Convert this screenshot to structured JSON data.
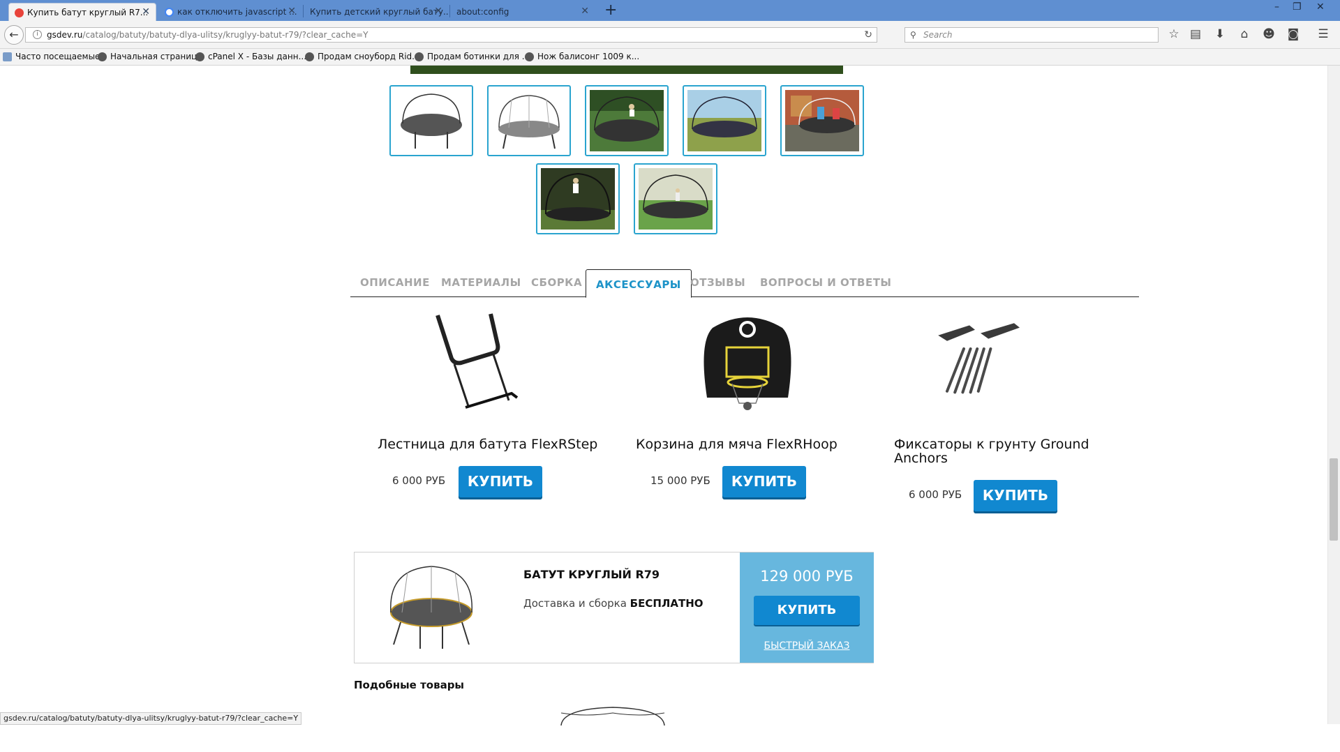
{
  "browser": {
    "tabs": [
      {
        "title": "Купить батут круглый R7...",
        "active": true
      },
      {
        "title": "как отключить javascript ...",
        "active": false
      },
      {
        "title": "Купить детский круглый бату...",
        "active": false
      },
      {
        "title": "about:config",
        "active": false
      }
    ],
    "new_tab_label": "+",
    "url_domain": "gsdev.ru",
    "url_path": "/catalog/batuty/batuty-dlya-ulitsy/kruglyy-batut-r79/?clear_cache=Y",
    "search_placeholder": "Search",
    "bookmarks": [
      "Часто посещаемые",
      "Начальная страница",
      "cPanel X - Базы данн...",
      "Продам сноуборд Rid...",
      "Продам ботинки для ...",
      "Нож балисонг 1009 к..."
    ],
    "status_url": "gsdev.ru/catalog/batuty/batuty-dlya-ulitsy/kruglyy-batut-r79/?clear_cache=Y"
  },
  "product_tabs": [
    {
      "label": "ОПИСАНИЕ",
      "active": false
    },
    {
      "label": "МАТЕРИАЛЫ",
      "active": false
    },
    {
      "label": "СБОРКА",
      "active": false
    },
    {
      "label": "АКСЕССУАРЫ",
      "active": true
    },
    {
      "label": "ОТЗЫВЫ",
      "active": false
    },
    {
      "label": "ВОПРОСЫ И ОТВЕТЫ",
      "active": false
    }
  ],
  "accessories": [
    {
      "title": "Лестница для батута FlexRStep",
      "price": "6 000 РУБ",
      "buy_label": "КУПИТЬ",
      "icon": "ladder"
    },
    {
      "title": "Корзина для мяча FlexRHoop",
      "price": "15 000 РУБ",
      "buy_label": "КУПИТЬ",
      "icon": "basketball-hoop"
    },
    {
      "title": "Фиксаторы к грунту Ground Anchors",
      "price": "6 000 РУБ",
      "buy_label": "КУПИТЬ",
      "icon": "ground-anchors"
    }
  ],
  "buybox": {
    "title": "БАТУТ КРУГЛЫЙ R79",
    "delivery_text": "Доставка и сборка ",
    "delivery_free": "БЕСПЛАТНО",
    "price": "129 000 РУБ",
    "buy_label": "КУПИТЬ",
    "quick_order": "БЫСТРЫЙ ЗАКАЗ"
  },
  "similar_title": "Подобные товары",
  "colors": {
    "accent": "#1188d0",
    "thumb_border": "#2aa4cf",
    "buybox_panel": "#67b7de",
    "tab_active": "#1d93c8"
  }
}
